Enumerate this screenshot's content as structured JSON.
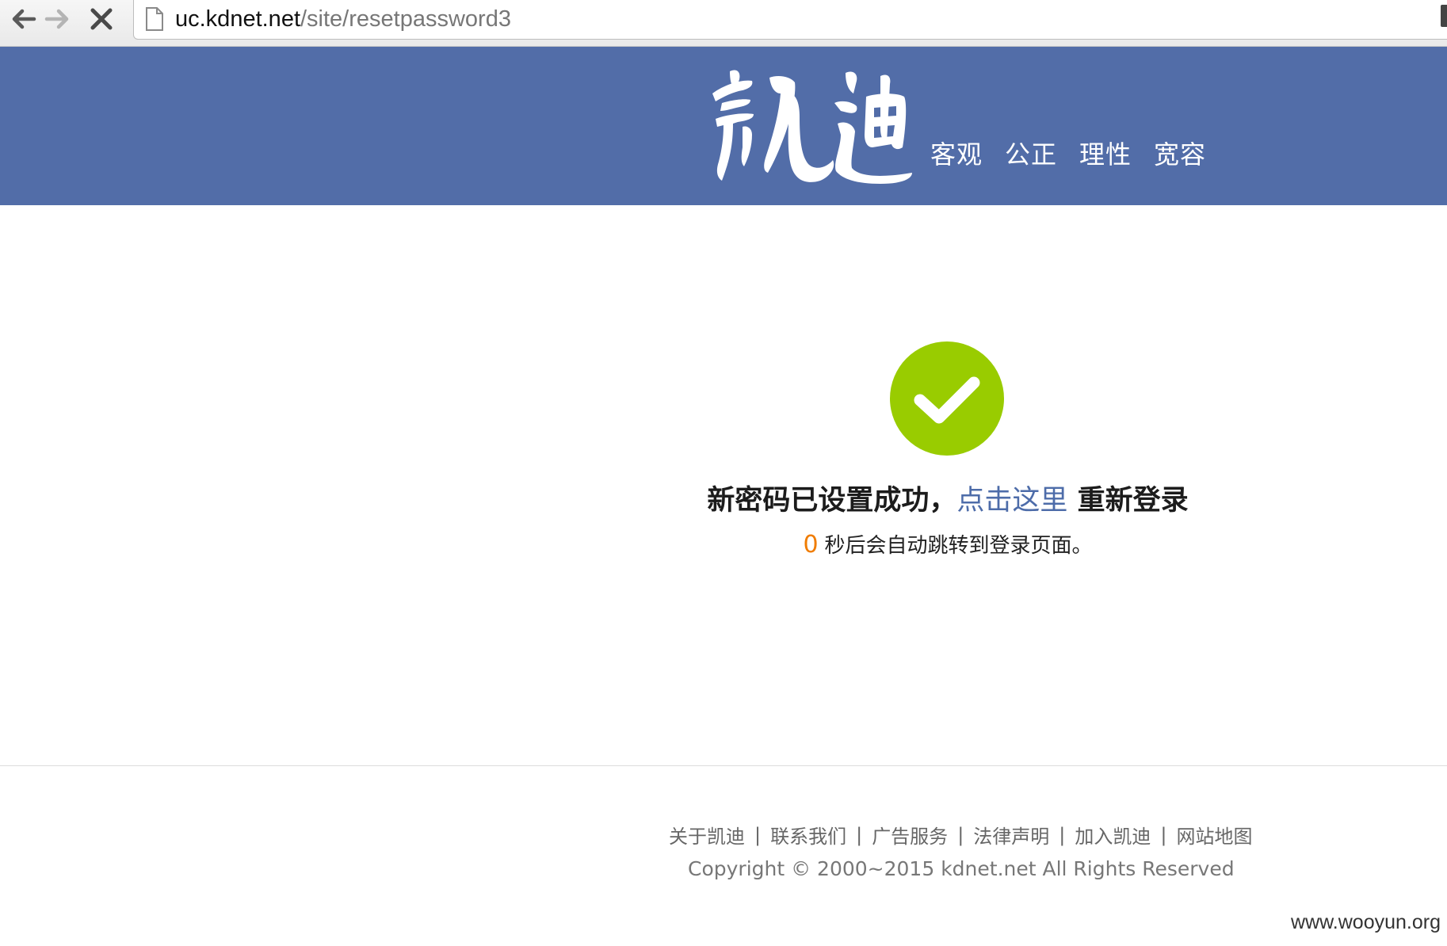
{
  "browser": {
    "url_host": "uc.kdnet.net",
    "url_path": "/site/resetpassword3"
  },
  "header": {
    "logo_text": "凯迪",
    "slogan": [
      "客观",
      "公正",
      "理性",
      "宽容"
    ],
    "background_color": "#526da8"
  },
  "success": {
    "icon": "check-circle-icon",
    "icon_color": "#99cc00",
    "message_prefix": "新密码已设置成功，",
    "link_text": "点击这里",
    "message_suffix": " 重新登录",
    "countdown": "0",
    "redirect_text": "秒后会自动跳转到登录页面。"
  },
  "footer": {
    "links": [
      "关于凯迪",
      "联系我们",
      "广告服务",
      "法律声明",
      "加入凯迪",
      "网站地图"
    ],
    "copyright": "Copyright © 2000~2015 kdnet.net All Rights Reserved"
  },
  "watermark": "www.wooyun.org"
}
